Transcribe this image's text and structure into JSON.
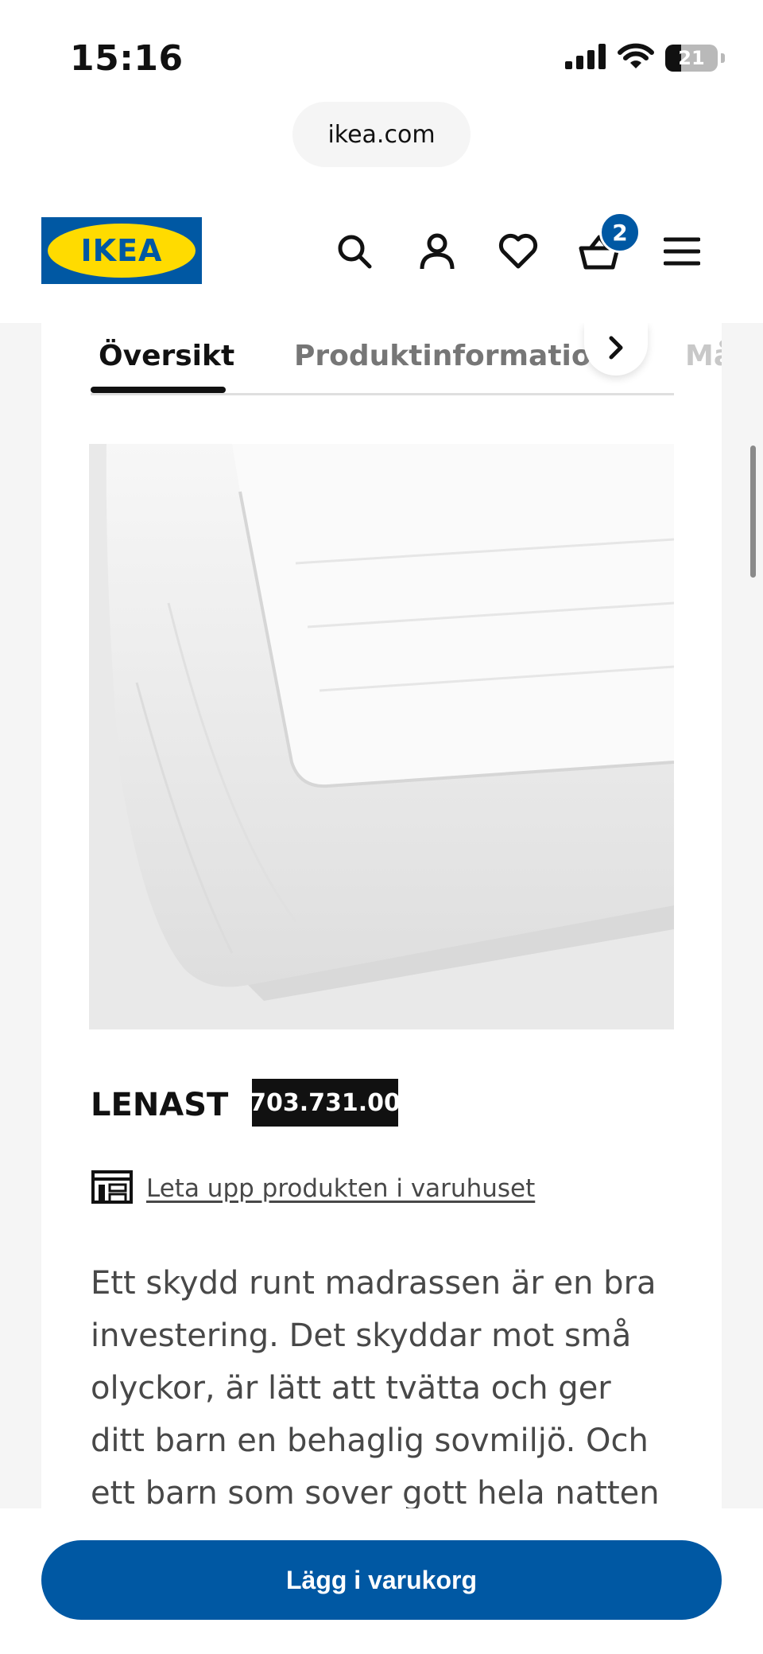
{
  "status_bar": {
    "time": "15:16",
    "battery_level": "21",
    "icons": [
      "signal-icon",
      "wifi-icon",
      "battery-icon"
    ]
  },
  "browser": {
    "url": "ikea.com"
  },
  "header": {
    "logo_text": "IKEA",
    "cart_count": "2",
    "icons": [
      "search-icon",
      "account-icon",
      "heart-icon",
      "cart-icon",
      "menu-icon"
    ],
    "colors": {
      "brand_blue": "#0058a3",
      "brand_yellow": "#ffdb00"
    }
  },
  "tabs": {
    "items": [
      {
        "label": "Översikt",
        "active": true
      },
      {
        "label": "Produktinformation",
        "active": false
      },
      {
        "label": "Må",
        "active": false
      }
    ],
    "next_icon": "chevron-right-icon"
  },
  "product": {
    "name": "LENAST",
    "article_number": "703.731.00",
    "store_link_label": "Leta upp produkten i varuhuset",
    "store_icon": "store-icon",
    "description": "Ett skydd runt madrassen är en bra investering. Det skyddar mot små olyckor, är lätt att tvätta och ger ditt barn en behaglig sovmiljö. Och ett barn som sover gott hela natten är ju"
  },
  "cta": {
    "add_to_cart_label": "Lägg i varukorg",
    "color": "#0058a3"
  }
}
